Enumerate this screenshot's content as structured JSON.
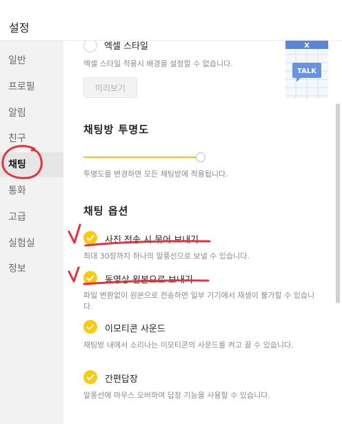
{
  "header": {
    "title": "설정"
  },
  "sidebar": {
    "items": [
      {
        "label": "일반"
      },
      {
        "label": "프로필"
      },
      {
        "label": "알림"
      },
      {
        "label": "친구"
      },
      {
        "label": "채팅",
        "active": true
      },
      {
        "label": "통화"
      },
      {
        "label": "고급"
      },
      {
        "label": "실험실"
      },
      {
        "label": "정보"
      }
    ]
  },
  "excel_style": {
    "label": "엑셀 스타일",
    "desc": "엑셀 스타일 적용시 배경을 설정할 수 없습니다.",
    "preview_button": "미리보기",
    "preview_badges": [
      "X",
      "TALK"
    ]
  },
  "transparency": {
    "title": "채팅방 투명도",
    "desc": "투명도를 변경하면 모든 채팅방에 적용됩니다.",
    "level": 1.0
  },
  "chat_options": {
    "title": "채팅 옵션",
    "items": [
      {
        "label": "사진 전송 시 묶어 보내기",
        "desc": "최대 30장까지 하나의 말풍선으로 보낼 수 있습니다.",
        "checked": true
      },
      {
        "label": "동영상 원본으로 보내기",
        "desc": "파일 변환없이 원본으로 전송하면 일부 기기에서 재생이 불가할 수 있습니다.",
        "checked": true
      },
      {
        "label": "이모티콘 사운드",
        "desc": "채팅방 내에서 소리나는 이모티콘의 사운드를 켜고 끌 수 있습니다.",
        "checked": true
      },
      {
        "label": "간편답장",
        "desc": "말풍선에 마우스 오버하여 답장 기능을 사용할 수 있습니다.",
        "checked": true
      }
    ]
  },
  "colors": {
    "accent": "#fbc90e",
    "annotation": "#e8303b",
    "preview_blue": "#5b85d6"
  }
}
